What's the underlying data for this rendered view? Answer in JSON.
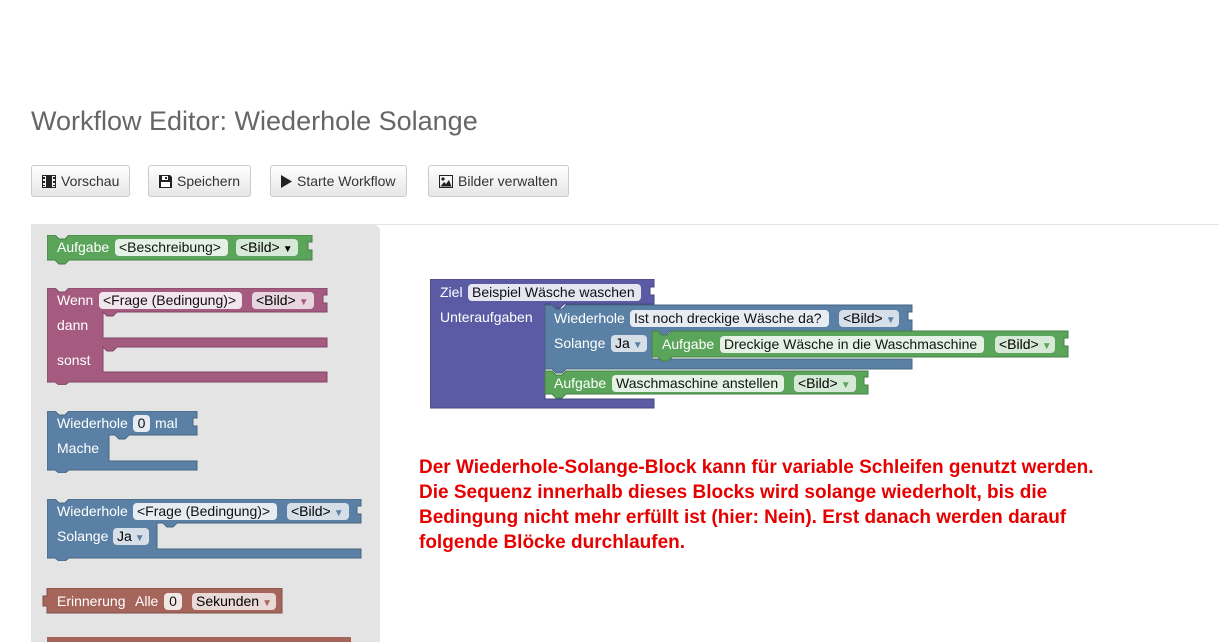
{
  "page": {
    "title": "Workflow Editor: Wiederhole Solange"
  },
  "toolbar": {
    "buttons": [
      {
        "label": "Vorschau",
        "icon": "film-icon"
      },
      {
        "label": "Speichern",
        "icon": "floppy-icon"
      },
      {
        "label": "Starte Workflow",
        "icon": "play-icon"
      },
      {
        "label": "Bilder verwalten",
        "icon": "picture-icon"
      }
    ]
  },
  "colors": {
    "task_green": "#5ba55b",
    "if_pink": "#a55b80",
    "loop_blue": "#5b80a5",
    "goal_purple": "#5b5ba5",
    "reminder_red": "#a5655b",
    "toolbox_bg": "#e4e4e4",
    "description_red": "#e60000"
  },
  "toolbox": {
    "task": {
      "label": "Aufgabe",
      "field": "<Beschreibung>",
      "image": "<Bild>"
    },
    "if_block": {
      "label": "Wenn",
      "field": "<Frage (Bedingung)>",
      "image": "<Bild>",
      "then": "dann",
      "else": "sonst"
    },
    "repeat_times": {
      "label": "Wiederhole",
      "count": "0",
      "suffix": "mal",
      "do": "Mache"
    },
    "repeat_while": {
      "label": "Wiederhole",
      "field": "<Frage (Bedingung)>",
      "image": "<Bild>",
      "while": "Solange",
      "answer": "Ja"
    },
    "reminder": {
      "label": "Erinnerung",
      "every": "Alle",
      "count": "0",
      "unit": "Sekunden"
    }
  },
  "workspace": {
    "goal": {
      "label": "Ziel",
      "name": "Beispiel Wäsche waschen",
      "subtasks": "Unteraufgaben"
    },
    "loop": {
      "label": "Wiederhole",
      "question": "Ist noch dreckige Wäsche da?",
      "image": "<Bild>",
      "while": "Solange",
      "answer": "Ja"
    },
    "inner_task": {
      "label": "Aufgabe",
      "name": "Dreckige Wäsche in die Waschmaschine",
      "image": "<Bild>"
    },
    "after_task": {
      "label": "Aufgabe",
      "name": "Waschmaschine anstellen",
      "image": "<Bild>"
    }
  },
  "description": {
    "lines": [
      "Der Wiederhole-Solange-Block kann für variable Schleifen genutzt werden.",
      "Die Sequenz innerhalb dieses Blocks wird solange wiederholt, bis die",
      "Bedingung nicht mehr erfüllt ist (hier: Nein). Erst danach werden darauf",
      "folgende Blöcke durchlaufen."
    ]
  }
}
